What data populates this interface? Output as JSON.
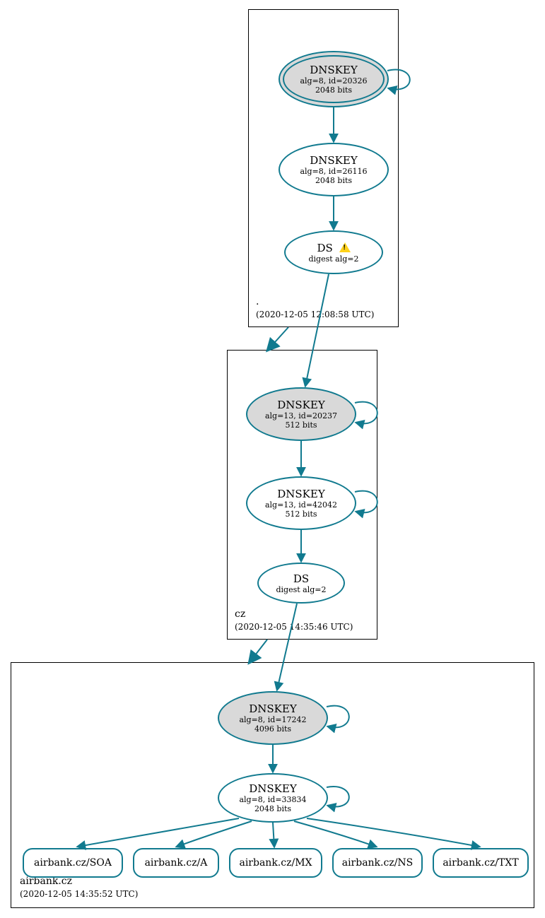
{
  "zones": {
    "root": {
      "name": ".",
      "timestamp": "(2020-12-05 12:08:58 UTC)"
    },
    "cz": {
      "name": "cz",
      "timestamp": "(2020-12-05 14:35:46 UTC)"
    },
    "leaf": {
      "name": "airbank.cz",
      "timestamp": "(2020-12-05 14:35:52 UTC)"
    }
  },
  "nodes": {
    "root_ksk": {
      "title": "DNSKEY",
      "line1": "alg=8, id=20326",
      "line2": "2048 bits"
    },
    "root_zsk": {
      "title": "DNSKEY",
      "line1": "alg=8, id=26116",
      "line2": "2048 bits"
    },
    "root_ds": {
      "title": "DS",
      "line1": "digest alg=2"
    },
    "cz_ksk": {
      "title": "DNSKEY",
      "line1": "alg=13, id=20237",
      "line2": "512 bits"
    },
    "cz_zsk": {
      "title": "DNSKEY",
      "line1": "alg=13, id=42042",
      "line2": "512 bits"
    },
    "cz_ds": {
      "title": "DS",
      "line1": "digest alg=2"
    },
    "leaf_ksk": {
      "title": "DNSKEY",
      "line1": "alg=8, id=17242",
      "line2": "4096 bits"
    },
    "leaf_zsk": {
      "title": "DNSKEY",
      "line1": "alg=8, id=33834",
      "line2": "2048 bits"
    }
  },
  "rrsets": {
    "soa": "airbank.cz/SOA",
    "a": "airbank.cz/A",
    "mx": "airbank.cz/MX",
    "ns": "airbank.cz/NS",
    "txt": "airbank.cz/TXT"
  },
  "colors": {
    "stroke": "#117a8f",
    "fill_grey": "#d9d9d9"
  }
}
